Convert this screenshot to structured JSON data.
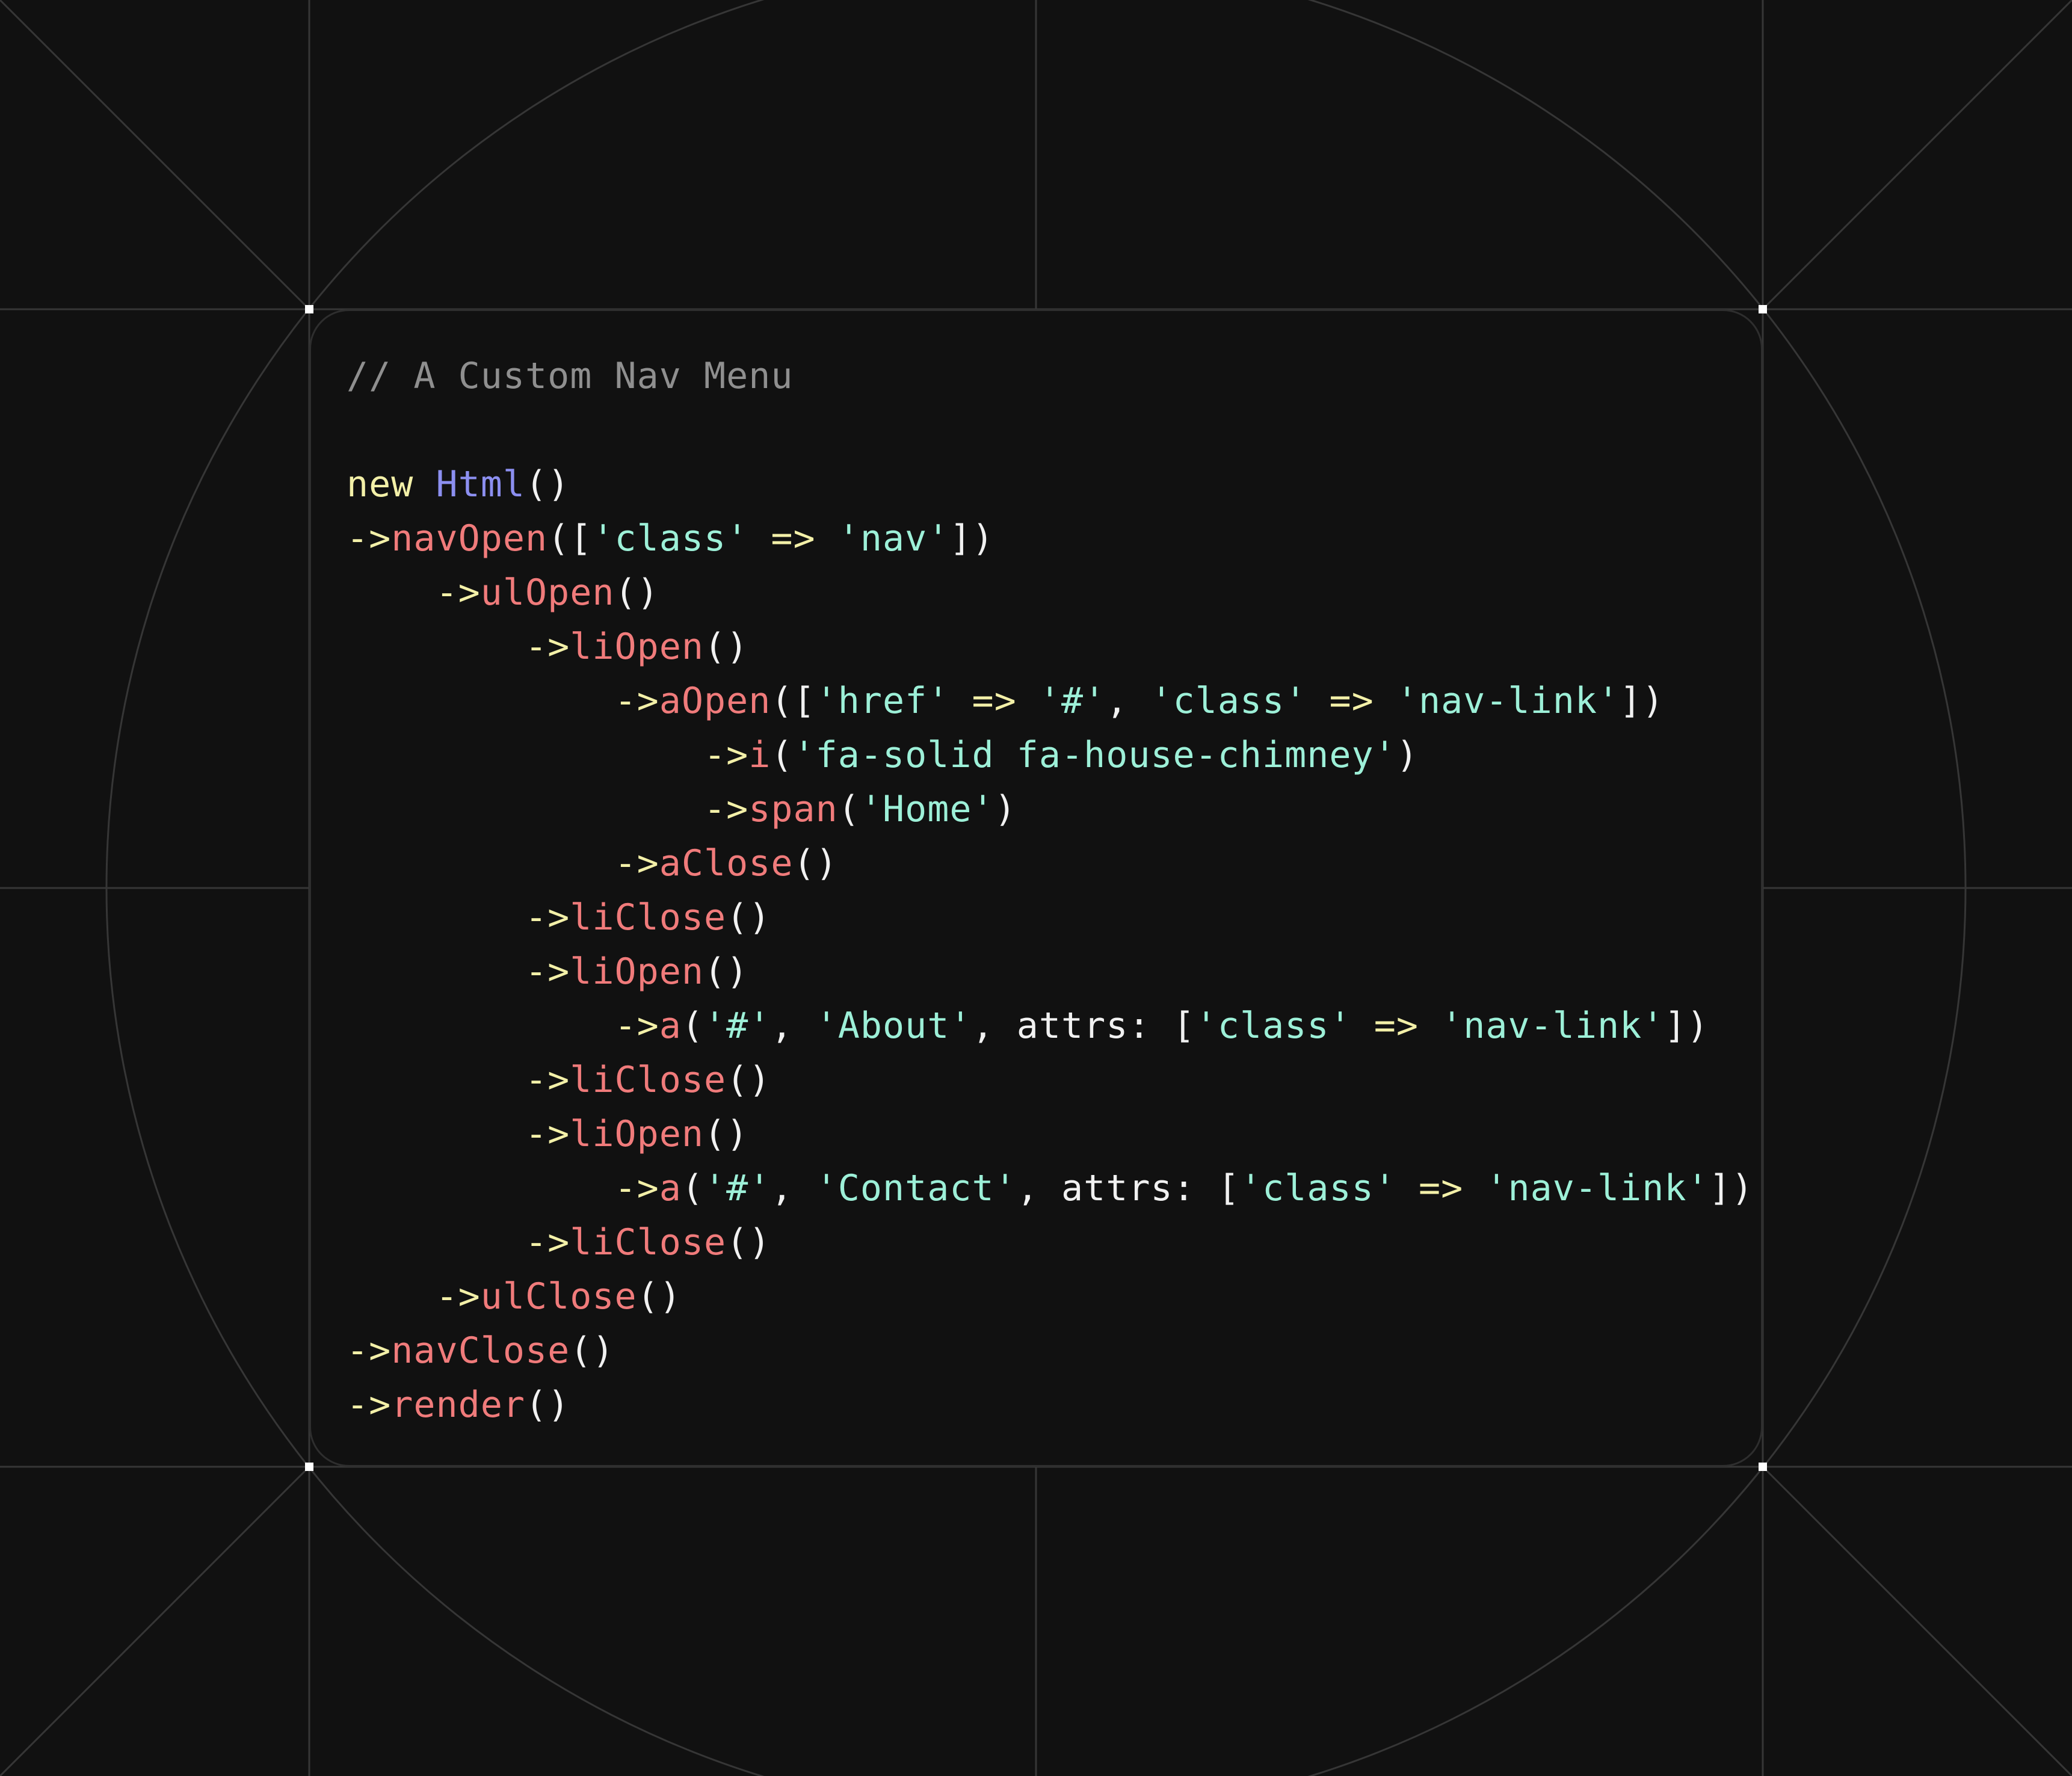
{
  "colors": {
    "background": "#111111",
    "grid_line": "#363636",
    "card_border": "#2e2e2e",
    "corner_marker": "#ffffff",
    "comment": "#8f8f8f",
    "keyword": "#f3f0a8",
    "class_name": "#8c8ff0",
    "method": "#f07b7b",
    "string": "#9df0d8",
    "operator": "#f3f0a8",
    "punctuation": "#f1f1f1"
  },
  "code": {
    "lines": [
      [
        {
          "t": "comment",
          "v": "// A Custom Nav Menu"
        }
      ],
      [],
      [
        {
          "t": "keyword",
          "v": "new"
        },
        {
          "t": "punct",
          "v": " "
        },
        {
          "t": "class",
          "v": "Html"
        },
        {
          "t": "punct",
          "v": "()"
        }
      ],
      [
        {
          "t": "arrow",
          "v": "->"
        },
        {
          "t": "method",
          "v": "navOpen"
        },
        {
          "t": "punct",
          "v": "(["
        },
        {
          "t": "string",
          "v": "'class'"
        },
        {
          "t": "punct",
          "v": " "
        },
        {
          "t": "op",
          "v": "=>"
        },
        {
          "t": "punct",
          "v": " "
        },
        {
          "t": "string",
          "v": "'nav'"
        },
        {
          "t": "punct",
          "v": "])"
        }
      ],
      [
        {
          "t": "punct",
          "v": "    "
        },
        {
          "t": "arrow",
          "v": "->"
        },
        {
          "t": "method",
          "v": "ulOpen"
        },
        {
          "t": "punct",
          "v": "()"
        }
      ],
      [
        {
          "t": "punct",
          "v": "        "
        },
        {
          "t": "arrow",
          "v": "->"
        },
        {
          "t": "method",
          "v": "liOpen"
        },
        {
          "t": "punct",
          "v": "()"
        }
      ],
      [
        {
          "t": "punct",
          "v": "            "
        },
        {
          "t": "arrow",
          "v": "->"
        },
        {
          "t": "method",
          "v": "aOpen"
        },
        {
          "t": "punct",
          "v": "(["
        },
        {
          "t": "string",
          "v": "'href'"
        },
        {
          "t": "punct",
          "v": " "
        },
        {
          "t": "op",
          "v": "=>"
        },
        {
          "t": "punct",
          "v": " "
        },
        {
          "t": "string",
          "v": "'#'"
        },
        {
          "t": "punct",
          "v": ", "
        },
        {
          "t": "string",
          "v": "'class'"
        },
        {
          "t": "punct",
          "v": " "
        },
        {
          "t": "op",
          "v": "=>"
        },
        {
          "t": "punct",
          "v": " "
        },
        {
          "t": "string",
          "v": "'nav-link'"
        },
        {
          "t": "punct",
          "v": "])"
        }
      ],
      [
        {
          "t": "punct",
          "v": "                "
        },
        {
          "t": "arrow",
          "v": "->"
        },
        {
          "t": "method",
          "v": "i"
        },
        {
          "t": "punct",
          "v": "("
        },
        {
          "t": "string",
          "v": "'fa-solid fa-house-chimney'"
        },
        {
          "t": "punct",
          "v": ")"
        }
      ],
      [
        {
          "t": "punct",
          "v": "                "
        },
        {
          "t": "arrow",
          "v": "->"
        },
        {
          "t": "method",
          "v": "span"
        },
        {
          "t": "punct",
          "v": "("
        },
        {
          "t": "string",
          "v": "'Home'"
        },
        {
          "t": "punct",
          "v": ")"
        }
      ],
      [
        {
          "t": "punct",
          "v": "            "
        },
        {
          "t": "arrow",
          "v": "->"
        },
        {
          "t": "method",
          "v": "aClose"
        },
        {
          "t": "punct",
          "v": "()"
        }
      ],
      [
        {
          "t": "punct",
          "v": "        "
        },
        {
          "t": "arrow",
          "v": "->"
        },
        {
          "t": "method",
          "v": "liClose"
        },
        {
          "t": "punct",
          "v": "()"
        }
      ],
      [
        {
          "t": "punct",
          "v": "        "
        },
        {
          "t": "arrow",
          "v": "->"
        },
        {
          "t": "method",
          "v": "liOpen"
        },
        {
          "t": "punct",
          "v": "()"
        }
      ],
      [
        {
          "t": "punct",
          "v": "            "
        },
        {
          "t": "arrow",
          "v": "->"
        },
        {
          "t": "method",
          "v": "a"
        },
        {
          "t": "punct",
          "v": "("
        },
        {
          "t": "string",
          "v": "'#'"
        },
        {
          "t": "punct",
          "v": ", "
        },
        {
          "t": "string",
          "v": "'About'"
        },
        {
          "t": "punct",
          "v": ", "
        },
        {
          "t": "ident",
          "v": "attrs:"
        },
        {
          "t": "punct",
          "v": " ["
        },
        {
          "t": "string",
          "v": "'class'"
        },
        {
          "t": "punct",
          "v": " "
        },
        {
          "t": "op",
          "v": "=>"
        },
        {
          "t": "punct",
          "v": " "
        },
        {
          "t": "string",
          "v": "'nav-link'"
        },
        {
          "t": "punct",
          "v": "])"
        }
      ],
      [
        {
          "t": "punct",
          "v": "        "
        },
        {
          "t": "arrow",
          "v": "->"
        },
        {
          "t": "method",
          "v": "liClose"
        },
        {
          "t": "punct",
          "v": "()"
        }
      ],
      [
        {
          "t": "punct",
          "v": "        "
        },
        {
          "t": "arrow",
          "v": "->"
        },
        {
          "t": "method",
          "v": "liOpen"
        },
        {
          "t": "punct",
          "v": "()"
        }
      ],
      [
        {
          "t": "punct",
          "v": "            "
        },
        {
          "t": "arrow",
          "v": "->"
        },
        {
          "t": "method",
          "v": "a"
        },
        {
          "t": "punct",
          "v": "("
        },
        {
          "t": "string",
          "v": "'#'"
        },
        {
          "t": "punct",
          "v": ", "
        },
        {
          "t": "string",
          "v": "'Contact'"
        },
        {
          "t": "punct",
          "v": ", "
        },
        {
          "t": "ident",
          "v": "attrs:"
        },
        {
          "t": "punct",
          "v": " ["
        },
        {
          "t": "string",
          "v": "'class'"
        },
        {
          "t": "punct",
          "v": " "
        },
        {
          "t": "op",
          "v": "=>"
        },
        {
          "t": "punct",
          "v": " "
        },
        {
          "t": "string",
          "v": "'nav-link'"
        },
        {
          "t": "punct",
          "v": "])"
        }
      ],
      [
        {
          "t": "punct",
          "v": "        "
        },
        {
          "t": "arrow",
          "v": "->"
        },
        {
          "t": "method",
          "v": "liClose"
        },
        {
          "t": "punct",
          "v": "()"
        }
      ],
      [
        {
          "t": "punct",
          "v": "    "
        },
        {
          "t": "arrow",
          "v": "->"
        },
        {
          "t": "method",
          "v": "ulClose"
        },
        {
          "t": "punct",
          "v": "()"
        }
      ],
      [
        {
          "t": "arrow",
          "v": "->"
        },
        {
          "t": "method",
          "v": "navClose"
        },
        {
          "t": "punct",
          "v": "()"
        }
      ],
      [
        {
          "t": "arrow",
          "v": "->"
        },
        {
          "t": "method",
          "v": "render"
        },
        {
          "t": "punct",
          "v": "()"
        }
      ]
    ]
  }
}
